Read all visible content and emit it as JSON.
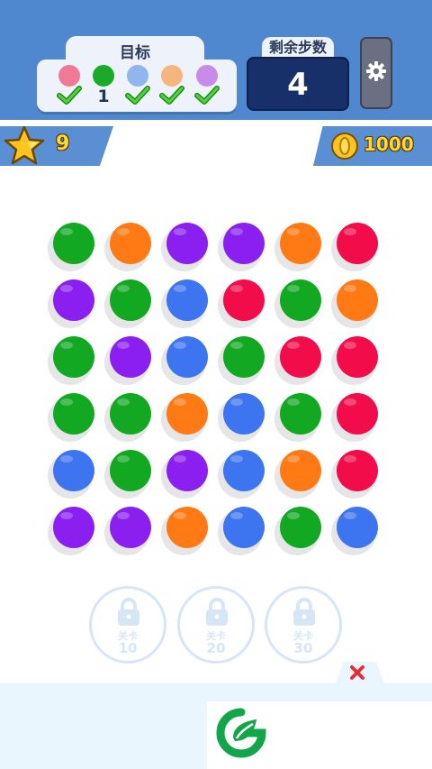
{
  "header": {
    "goal_title": "目标",
    "goals": [
      {
        "color": "#f07a95",
        "status": "done",
        "count": ""
      },
      {
        "color": "#1aaa2a",
        "status": "count",
        "count": "1"
      },
      {
        "color": "#93b5ee",
        "status": "done",
        "count": ""
      },
      {
        "color": "#f5b57e",
        "status": "done",
        "count": ""
      },
      {
        "color": "#c68ce8",
        "status": "done",
        "count": ""
      }
    ],
    "steps_label": "剩余步数",
    "steps_value": "4",
    "settings_icon": "gear-icon"
  },
  "stats": {
    "stars": "9",
    "coins": "1000"
  },
  "board": {
    "rows": 6,
    "cols": 6,
    "cells": [
      [
        "green",
        "orange",
        "purple",
        "purple",
        "orange",
        "red"
      ],
      [
        "purple",
        "green",
        "blue",
        "red",
        "green",
        "orange"
      ],
      [
        "green",
        "purple",
        "blue",
        "green",
        "red",
        "red"
      ],
      [
        "green",
        "green",
        "orange",
        "blue",
        "green",
        "red"
      ],
      [
        "blue",
        "green",
        "purple",
        "blue",
        "orange",
        "red"
      ],
      [
        "purple",
        "purple",
        "orange",
        "blue",
        "green",
        "blue"
      ]
    ]
  },
  "palette": {
    "green": "#12a822",
    "orange": "#ff7a15",
    "purple": "#8a1ff0",
    "red": "#f20c4a",
    "blue": "#3d74ef"
  },
  "levels": [
    {
      "label": "关卡",
      "number": "10"
    },
    {
      "label": "关卡",
      "number": "20"
    },
    {
      "label": "关卡",
      "number": "30"
    }
  ],
  "colors": {
    "header_bg": "#4f88cf",
    "steps_bg": "#18306a",
    "coin_text": "#ffd83a"
  }
}
